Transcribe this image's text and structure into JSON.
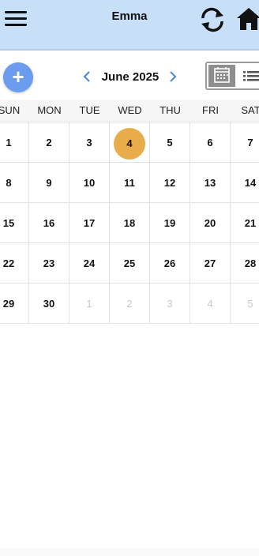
{
  "app": {
    "title": "Emma"
  },
  "toolbar": {
    "menu_icon": "hamburger-menu-icon",
    "sync_icon": "sync-icon",
    "home_icon": "home-icon"
  },
  "calendar": {
    "add_label": "+",
    "month_label": "June 2025",
    "prev_icon": "chevron-left-icon",
    "next_icon": "chevron-right-icon",
    "view_calendar_icon": "calendar-view-icon",
    "view_list_icon": "list-view-icon",
    "weekdays": [
      "SUN",
      "MON",
      "TUE",
      "WED",
      "THU",
      "FRI",
      "SAT"
    ],
    "weeks": [
      [
        "1",
        "2",
        "3",
        "4",
        "5",
        "6",
        "7"
      ],
      [
        "8",
        "9",
        "10",
        "11",
        "12",
        "13",
        "14"
      ],
      [
        "15",
        "16",
        "17",
        "18",
        "19",
        "20",
        "21"
      ],
      [
        "22",
        "23",
        "24",
        "25",
        "26",
        "27",
        "28"
      ],
      [
        "29",
        "30",
        "1",
        "2",
        "3",
        "4",
        "5"
      ]
    ],
    "today": "4",
    "colors": {
      "header_bg": "#c7e0f8",
      "today_bg": "#e9ac4a",
      "add_button": "#6b9cee",
      "nav_arrow": "#4a86d8",
      "other_month_text": "#c9c9c9"
    }
  }
}
